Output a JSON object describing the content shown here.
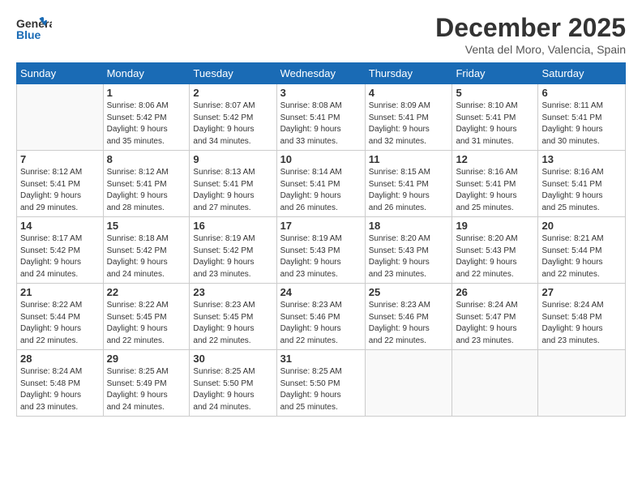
{
  "logo": {
    "line1": "General",
    "line2": "Blue"
  },
  "title": "December 2025",
  "subtitle": "Venta del Moro, Valencia, Spain",
  "weekdays": [
    "Sunday",
    "Monday",
    "Tuesday",
    "Wednesday",
    "Thursday",
    "Friday",
    "Saturday"
  ],
  "weeks": [
    [
      {
        "day": "",
        "info": ""
      },
      {
        "day": "1",
        "info": "Sunrise: 8:06 AM\nSunset: 5:42 PM\nDaylight: 9 hours\nand 35 minutes."
      },
      {
        "day": "2",
        "info": "Sunrise: 8:07 AM\nSunset: 5:42 PM\nDaylight: 9 hours\nand 34 minutes."
      },
      {
        "day": "3",
        "info": "Sunrise: 8:08 AM\nSunset: 5:41 PM\nDaylight: 9 hours\nand 33 minutes."
      },
      {
        "day": "4",
        "info": "Sunrise: 8:09 AM\nSunset: 5:41 PM\nDaylight: 9 hours\nand 32 minutes."
      },
      {
        "day": "5",
        "info": "Sunrise: 8:10 AM\nSunset: 5:41 PM\nDaylight: 9 hours\nand 31 minutes."
      },
      {
        "day": "6",
        "info": "Sunrise: 8:11 AM\nSunset: 5:41 PM\nDaylight: 9 hours\nand 30 minutes."
      }
    ],
    [
      {
        "day": "7",
        "info": "Sunrise: 8:12 AM\nSunset: 5:41 PM\nDaylight: 9 hours\nand 29 minutes."
      },
      {
        "day": "8",
        "info": "Sunrise: 8:12 AM\nSunset: 5:41 PM\nDaylight: 9 hours\nand 28 minutes."
      },
      {
        "day": "9",
        "info": "Sunrise: 8:13 AM\nSunset: 5:41 PM\nDaylight: 9 hours\nand 27 minutes."
      },
      {
        "day": "10",
        "info": "Sunrise: 8:14 AM\nSunset: 5:41 PM\nDaylight: 9 hours\nand 26 minutes."
      },
      {
        "day": "11",
        "info": "Sunrise: 8:15 AM\nSunset: 5:41 PM\nDaylight: 9 hours\nand 26 minutes."
      },
      {
        "day": "12",
        "info": "Sunrise: 8:16 AM\nSunset: 5:41 PM\nDaylight: 9 hours\nand 25 minutes."
      },
      {
        "day": "13",
        "info": "Sunrise: 8:16 AM\nSunset: 5:41 PM\nDaylight: 9 hours\nand 25 minutes."
      }
    ],
    [
      {
        "day": "14",
        "info": "Sunrise: 8:17 AM\nSunset: 5:42 PM\nDaylight: 9 hours\nand 24 minutes."
      },
      {
        "day": "15",
        "info": "Sunrise: 8:18 AM\nSunset: 5:42 PM\nDaylight: 9 hours\nand 24 minutes."
      },
      {
        "day": "16",
        "info": "Sunrise: 8:19 AM\nSunset: 5:42 PM\nDaylight: 9 hours\nand 23 minutes."
      },
      {
        "day": "17",
        "info": "Sunrise: 8:19 AM\nSunset: 5:43 PM\nDaylight: 9 hours\nand 23 minutes."
      },
      {
        "day": "18",
        "info": "Sunrise: 8:20 AM\nSunset: 5:43 PM\nDaylight: 9 hours\nand 23 minutes."
      },
      {
        "day": "19",
        "info": "Sunrise: 8:20 AM\nSunset: 5:43 PM\nDaylight: 9 hours\nand 22 minutes."
      },
      {
        "day": "20",
        "info": "Sunrise: 8:21 AM\nSunset: 5:44 PM\nDaylight: 9 hours\nand 22 minutes."
      }
    ],
    [
      {
        "day": "21",
        "info": "Sunrise: 8:22 AM\nSunset: 5:44 PM\nDaylight: 9 hours\nand 22 minutes."
      },
      {
        "day": "22",
        "info": "Sunrise: 8:22 AM\nSunset: 5:45 PM\nDaylight: 9 hours\nand 22 minutes."
      },
      {
        "day": "23",
        "info": "Sunrise: 8:23 AM\nSunset: 5:45 PM\nDaylight: 9 hours\nand 22 minutes."
      },
      {
        "day": "24",
        "info": "Sunrise: 8:23 AM\nSunset: 5:46 PM\nDaylight: 9 hours\nand 22 minutes."
      },
      {
        "day": "25",
        "info": "Sunrise: 8:23 AM\nSunset: 5:46 PM\nDaylight: 9 hours\nand 22 minutes."
      },
      {
        "day": "26",
        "info": "Sunrise: 8:24 AM\nSunset: 5:47 PM\nDaylight: 9 hours\nand 23 minutes."
      },
      {
        "day": "27",
        "info": "Sunrise: 8:24 AM\nSunset: 5:48 PM\nDaylight: 9 hours\nand 23 minutes."
      }
    ],
    [
      {
        "day": "28",
        "info": "Sunrise: 8:24 AM\nSunset: 5:48 PM\nDaylight: 9 hours\nand 23 minutes."
      },
      {
        "day": "29",
        "info": "Sunrise: 8:25 AM\nSunset: 5:49 PM\nDaylight: 9 hours\nand 24 minutes."
      },
      {
        "day": "30",
        "info": "Sunrise: 8:25 AM\nSunset: 5:50 PM\nDaylight: 9 hours\nand 24 minutes."
      },
      {
        "day": "31",
        "info": "Sunrise: 8:25 AM\nSunset: 5:50 PM\nDaylight: 9 hours\nand 25 minutes."
      },
      {
        "day": "",
        "info": ""
      },
      {
        "day": "",
        "info": ""
      },
      {
        "day": "",
        "info": ""
      }
    ]
  ]
}
